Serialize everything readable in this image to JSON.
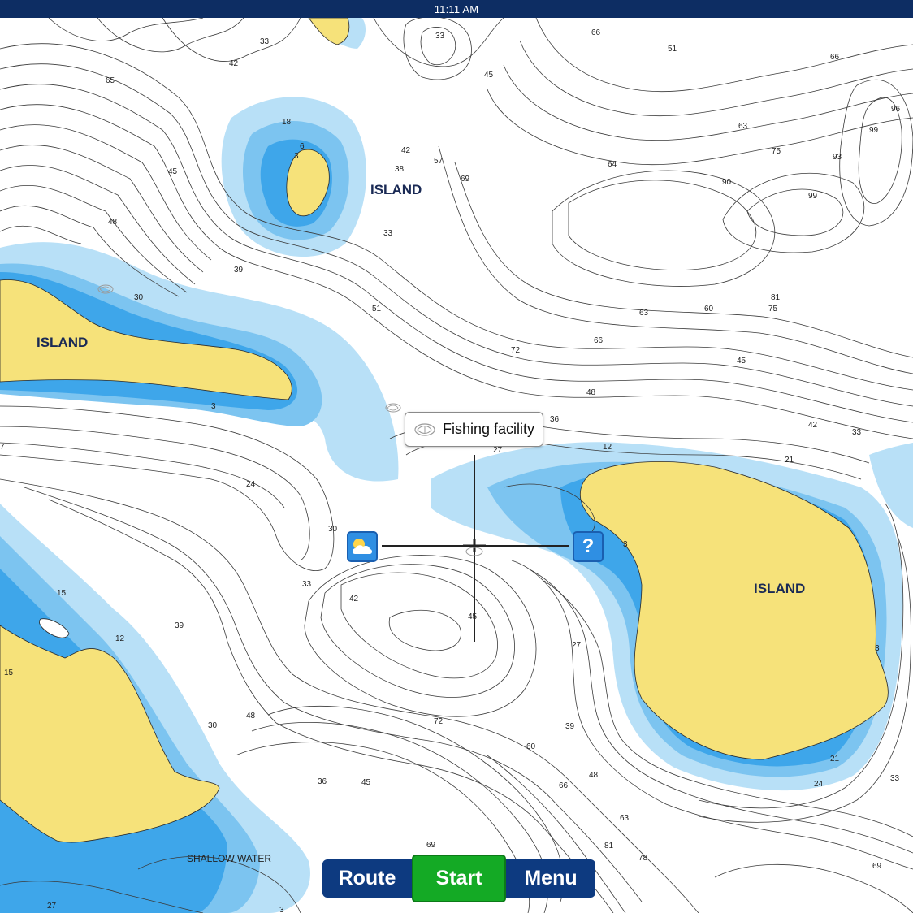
{
  "status_bar": {
    "time": "11:11 AM"
  },
  "map": {
    "island_labels": [
      "ISLAND",
      "ISLAND",
      "ISLAND"
    ],
    "area_labels": [
      "SHALLOW WATER"
    ],
    "depth_labels": [
      "33",
      "42",
      "65",
      "33",
      "66",
      "51",
      "66",
      "45",
      "18",
      "6",
      "3",
      "42",
      "38",
      "57",
      "69",
      "63",
      "96",
      "99",
      "75",
      "93",
      "64",
      "90",
      "99",
      "45",
      "48",
      "33",
      "39",
      "30",
      "51",
      "63",
      "60",
      "81",
      "75",
      "72",
      "66",
      "45",
      "48",
      "36",
      "42",
      "33",
      "27",
      "12",
      "21",
      "24",
      "30",
      "3",
      "33",
      "42",
      "15",
      "39",
      "12",
      "15",
      "45",
      "27",
      "48",
      "72",
      "39",
      "30",
      "60",
      "66",
      "36",
      "45",
      "48",
      "63",
      "81",
      "78",
      "69",
      "21",
      "24",
      "33",
      "69",
      "3",
      "27",
      "3",
      "7",
      "3"
    ],
    "poi": [
      {
        "type": "fishing",
        "icon": "fish-icon"
      },
      {
        "type": "fishing",
        "icon": "fish-icon"
      }
    ],
    "colors": {
      "land": "#f6e27a",
      "shallow": "#3ea6ea",
      "mid": "#7cc4f0",
      "deep_shelf": "#b8e0f7",
      "water": "#ffffff"
    }
  },
  "tooltip": {
    "label": "Fishing facility",
    "icon": "fish-icon"
  },
  "crosshair": {
    "weather_icon": "weather-partly-cloudy-icon",
    "help_label": "?",
    "help_icon": "help-icon"
  },
  "nav": {
    "route_label": "Route",
    "start_label": "Start",
    "menu_label": "Menu"
  }
}
